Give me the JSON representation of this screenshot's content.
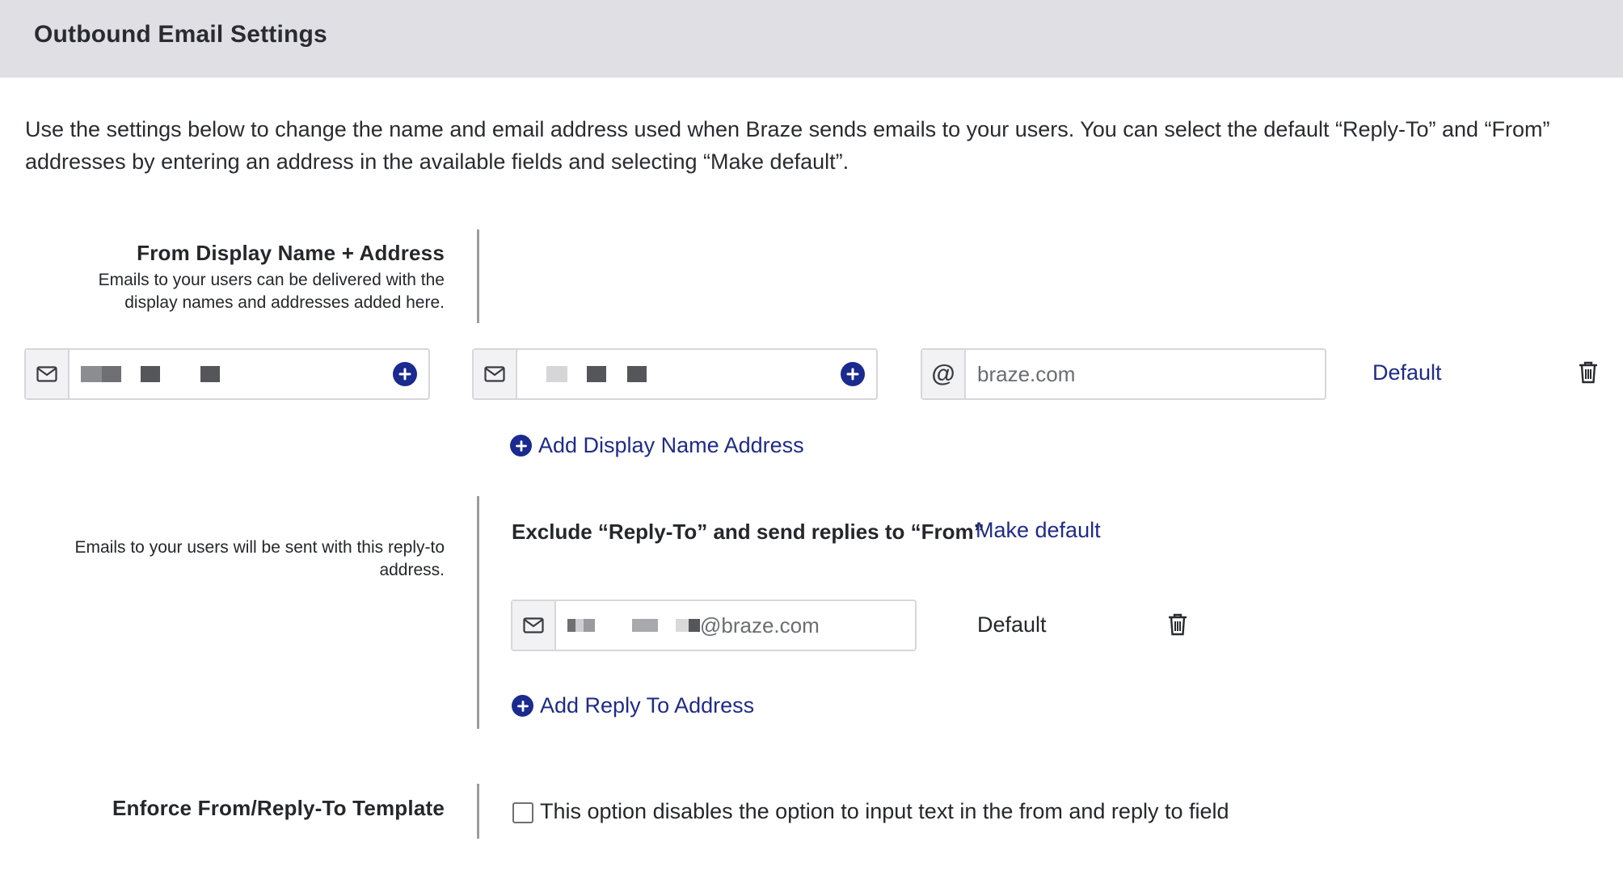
{
  "header": {
    "title": "Outbound Email Settings"
  },
  "intro": {
    "line1": "Use the settings below to change the name and email address used when Braze sends emails to your users. You can select the default “Reply-To” and “From”",
    "line2": "addresses by entering an address in the available fields and selecting “Make default”."
  },
  "from_section": {
    "title": "From Display Name + Address",
    "description_line1": "Emails to your users can be delivered with the",
    "description_line2": "display names and addresses added here.",
    "row": {
      "domain_value": "braze.com",
      "status": "Default",
      "icons": {
        "name_addon": "mail-icon",
        "address_addon": "mail-icon",
        "domain_addon": "at-icon",
        "delete": "trash-icon",
        "add": "plus-circle-icon"
      }
    },
    "add_link": "Add Display Name Address"
  },
  "reply_section": {
    "description_line1": "Emails to your users will be sent with this reply-to",
    "description_line2": "address.",
    "exclude_option": "Exclude “Reply-To” and send replies to “From”",
    "make_default": "Make default",
    "row": {
      "address_suffix": "@braze.com",
      "status": "Default",
      "icons": {
        "addon": "mail-icon",
        "delete": "trash-icon"
      }
    },
    "add_link": "Add Reply To Address"
  },
  "enforce_section": {
    "title": "Enforce From/Reply-To Template",
    "checkbox_label": "This option disables the option to input text in the from and reply to field",
    "checked": false
  },
  "colors": {
    "header_bg": "#dfdfe4",
    "link": "#1f2b88",
    "accent": "#1b2a8e",
    "divider": "#9a9ca2",
    "input_border": "#d6d7db",
    "addon_bg": "#f2f2f4"
  }
}
